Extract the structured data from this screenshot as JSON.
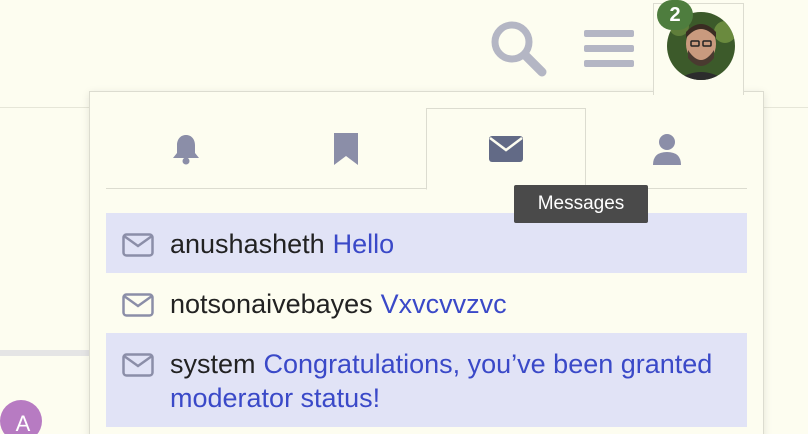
{
  "header": {
    "notification_count": "2",
    "icons": {
      "search": "search-icon",
      "menu": "hamburger-menu-icon",
      "avatar": "user-avatar"
    }
  },
  "left_partial": {
    "avatar_initial": "A"
  },
  "dropdown": {
    "tabs": [
      {
        "name": "notifications",
        "icon": "bell-icon",
        "active": false
      },
      {
        "name": "bookmarks",
        "icon": "bookmark-icon",
        "active": false
      },
      {
        "name": "messages",
        "icon": "envelope-icon",
        "active": true
      },
      {
        "name": "profile",
        "icon": "user-icon",
        "active": false
      }
    ],
    "tooltip": "Messages",
    "messages": [
      {
        "sender": "anushasheth",
        "text": "Hello",
        "unread": true
      },
      {
        "sender": "notsonaivebayes",
        "text": "Vxvcvvzvc",
        "unread": false
      },
      {
        "sender": "system",
        "text": "Congratulations, you’ve been granted moderator status!",
        "unread": true
      }
    ]
  },
  "colors": {
    "background": "#fdfdf0",
    "icon_gray": "#8b8ea8",
    "unread_bg": "#e1e3f6",
    "link_blue": "#3a49c8",
    "badge_green": "#4e7d3e"
  }
}
